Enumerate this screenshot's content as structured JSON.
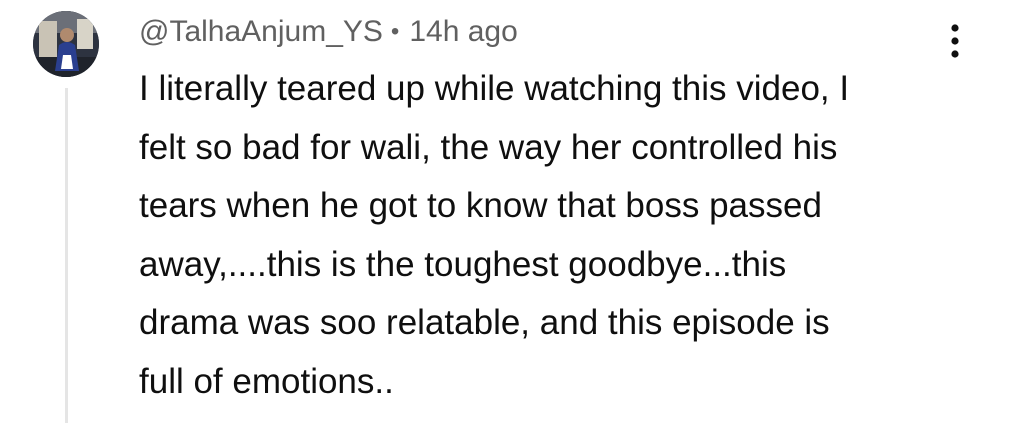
{
  "comment": {
    "handle": "@TalhaAnjum_YS",
    "separator": "•",
    "time_ago": "14h ago",
    "text_lines": [
      "I literally teared up while watching this video, I",
      "felt so bad for wali, the way her controlled his",
      "tears when he got to know that boss passed",
      "away,....this is the toughest goodbye...this",
      "drama was soo relatable, and this episode is",
      "full of emotions.."
    ],
    "avatar_icon": "user-avatar",
    "menu_icon": "more-vert-icon"
  },
  "colors": {
    "text_primary": "#0f0f0f",
    "text_secondary": "#606060",
    "thread_line": "#e5e5e5",
    "background": "#ffffff"
  }
}
